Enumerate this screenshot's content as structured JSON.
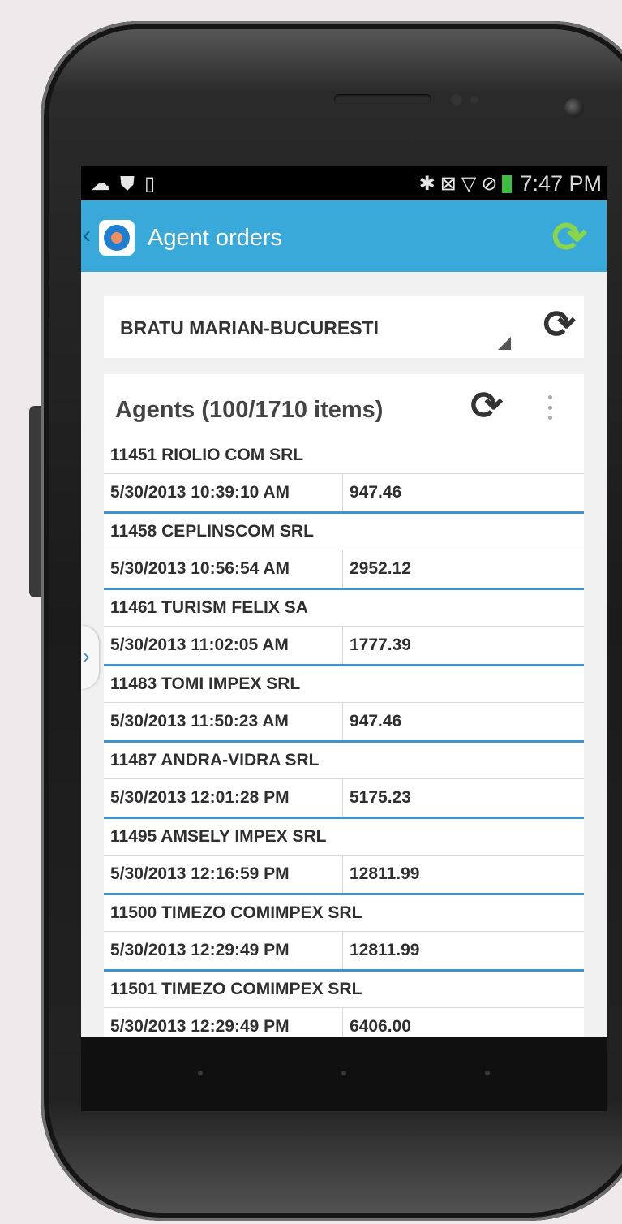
{
  "status_bar": {
    "left_icons": [
      "upload-cloud-icon",
      "shield-icon",
      "notification-icon"
    ],
    "right_icons": [
      "bluetooth-icon",
      "nfc-icon",
      "signal-icon",
      "no-sim-icon",
      "battery-icon"
    ],
    "time": "7:47 PM"
  },
  "action_bar": {
    "title": "Agent orders",
    "color": "#38a9d9",
    "refresh_icon_color": "#8bd54a"
  },
  "selector": {
    "value": "BRATU MARIAN-BUCURESTI"
  },
  "panel": {
    "title": "Agents (100/1710 items)"
  },
  "orders": [
    {
      "name": "11451 RIOLIO COM SRL",
      "date": "5/30/2013 10:39:10 AM",
      "amount": "947.46"
    },
    {
      "name": "11458 CEPLINSCOM SRL",
      "date": "5/30/2013 10:56:54 AM",
      "amount": "2952.12"
    },
    {
      "name": "11461 TURISM FELIX SA",
      "date": "5/30/2013 11:02:05 AM",
      "amount": "1777.39"
    },
    {
      "name": "11483 TOMI IMPEX SRL",
      "date": "5/30/2013 11:50:23 AM",
      "amount": "947.46"
    },
    {
      "name": "11487 ANDRA-VIDRA SRL",
      "date": "5/30/2013 12:01:28 PM",
      "amount": "5175.23"
    },
    {
      "name": "11495 AMSELY IMPEX SRL",
      "date": "5/30/2013 12:16:59 PM",
      "amount": "12811.99"
    },
    {
      "name": "11500 TIMEZO COMIMPEX SRL",
      "date": "5/30/2013 12:29:49 PM",
      "amount": "12811.99"
    },
    {
      "name": "11501 TIMEZO COMIMPEX SRL",
      "date": "5/30/2013 12:29:49 PM",
      "amount": "6406.00"
    }
  ]
}
